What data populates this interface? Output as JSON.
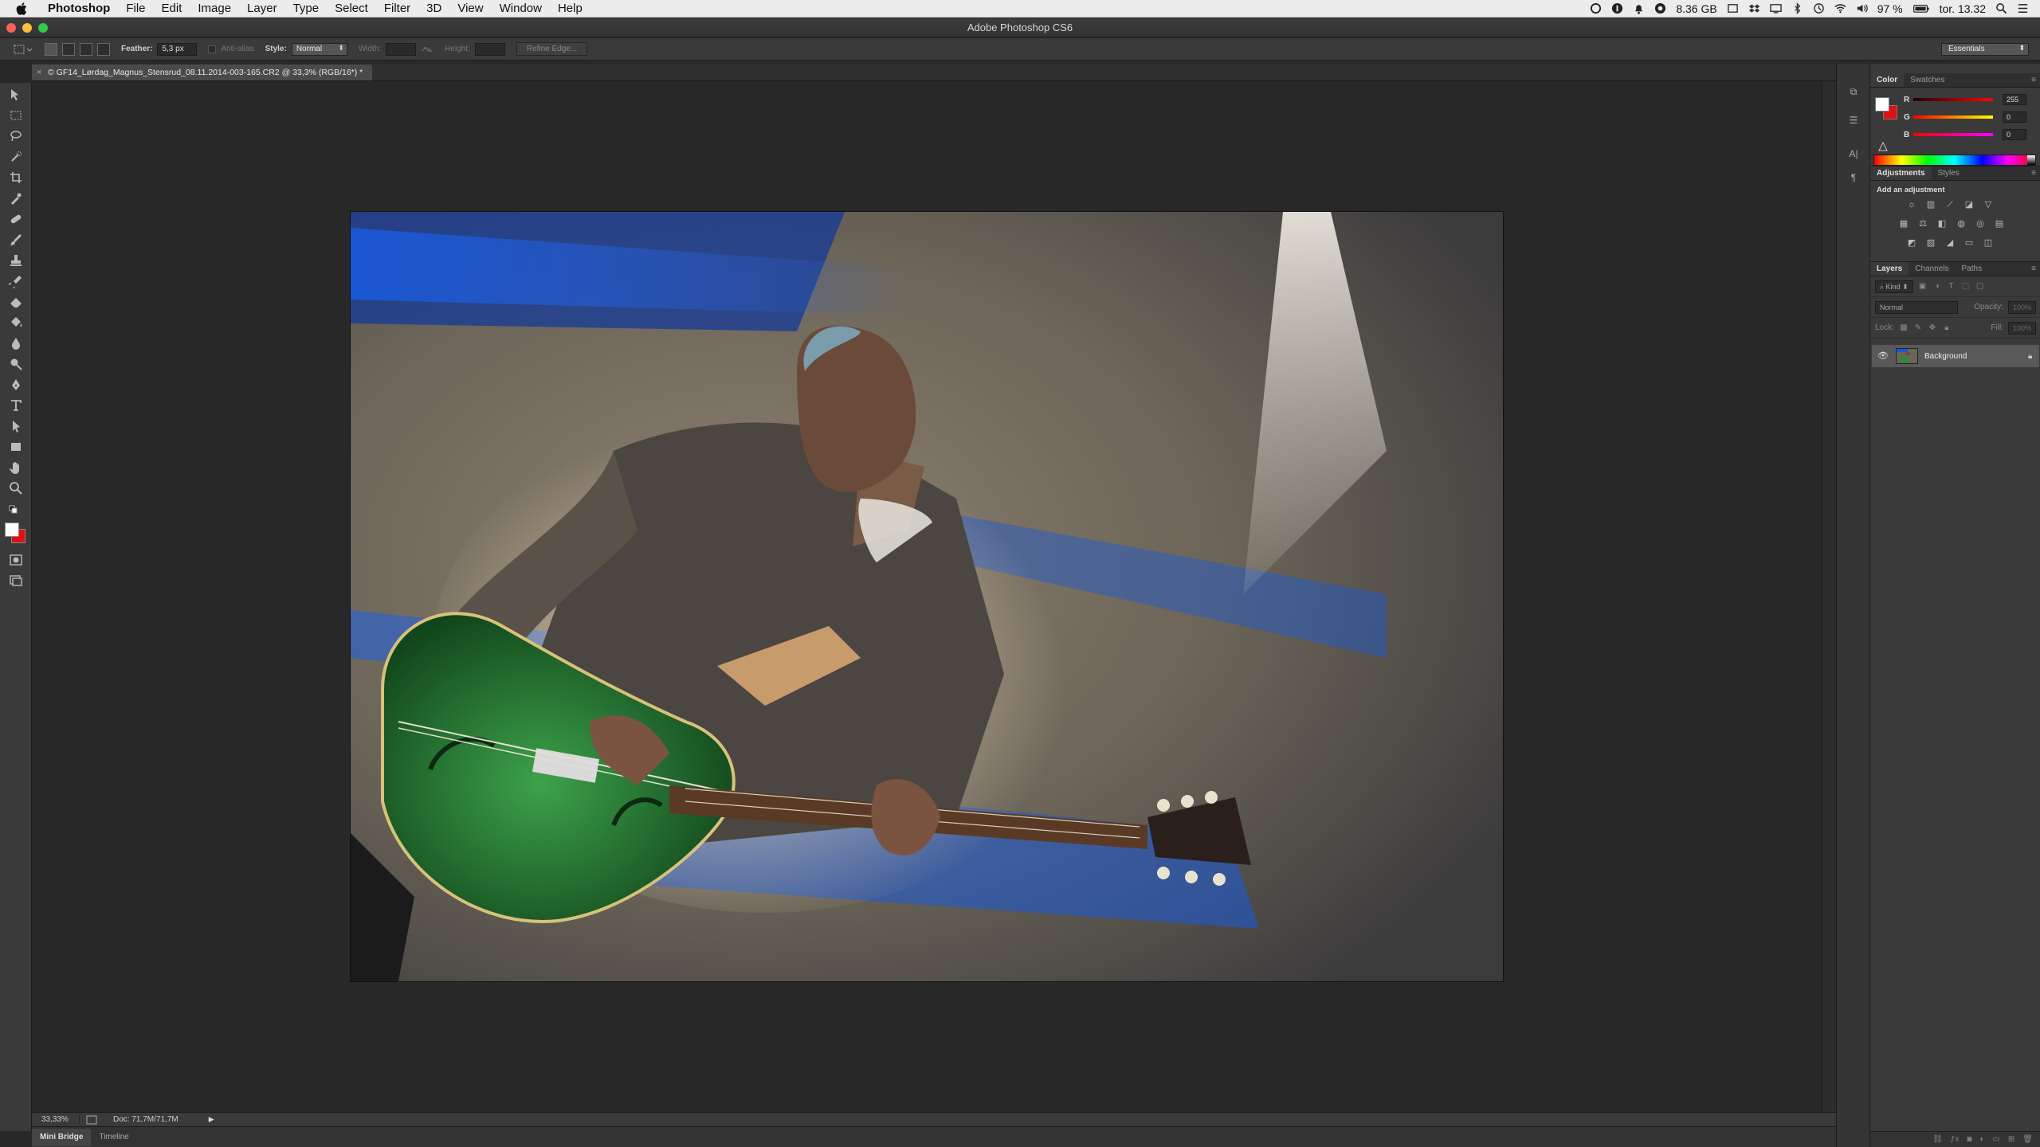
{
  "menubar": {
    "app_name": "Photoshop",
    "items": [
      "File",
      "Edit",
      "Image",
      "Layer",
      "Type",
      "Select",
      "Filter",
      "3D",
      "View",
      "Window",
      "Help"
    ],
    "status": {
      "storage": "8.36 GB",
      "battery": "97 %",
      "clock": "tor. 13.32"
    }
  },
  "window": {
    "title": "Adobe Photoshop CS6",
    "colors": {
      "close": "#fc605b",
      "minimize": "#fdbc40",
      "zoom": "#34c84a"
    }
  },
  "options_bar": {
    "feather_label": "Feather:",
    "feather_value": "5,3 px",
    "anti_alias_label": "Anti-alias",
    "style_label": "Style:",
    "style_value": "Normal",
    "width_label": "Width:",
    "height_label": "Height:",
    "refine_edge_label": "Refine Edge...",
    "workspace_value": "Essentials"
  },
  "document": {
    "tab_title": "© GF14_Lørdag_Magnus_Stensrud_08.11.2014-003-165.CR2 @ 33,3% (RGB/16*) *",
    "close_glyph": "×"
  },
  "tools": [
    "move-tool",
    "rectangular-marquee-tool",
    "lasso-tool",
    "quick-selection-tool",
    "crop-tool",
    "eyedropper-tool",
    "spot-healing-brush-tool",
    "brush-tool",
    "clone-stamp-tool",
    "history-brush-tool",
    "eraser-tool",
    "paint-bucket-tool",
    "blur-tool",
    "dodge-tool",
    "pen-tool",
    "type-tool",
    "path-selection-tool",
    "rectangle-tool",
    "hand-tool",
    "zoom-tool"
  ],
  "status_bar": {
    "zoom": "33,33%",
    "doc_info": "Doc: 71,7M/71,7M"
  },
  "bottom_tabs": [
    "Mini Bridge",
    "Timeline"
  ],
  "color_panel": {
    "tabs": [
      "Color",
      "Swatches"
    ],
    "foreground": "#ffffff",
    "background": "#e01010",
    "channels": [
      {
        "name": "R",
        "value": "255"
      },
      {
        "name": "G",
        "value": "0"
      },
      {
        "name": "B",
        "value": "0"
      }
    ]
  },
  "adjustments_panel": {
    "tabs": [
      "Adjustments",
      "Styles"
    ],
    "heading": "Add an adjustment"
  },
  "layers_panel": {
    "tabs": [
      "Layers",
      "Channels",
      "Paths"
    ],
    "kind_label": "Kind",
    "blend_mode": "Normal",
    "opacity_label": "Opacity:",
    "opacity_value": "100%",
    "lock_label": "Lock:",
    "fill_label": "Fill:",
    "fill_value": "100%",
    "layers": [
      {
        "name": "Background",
        "visible": true,
        "locked": true
      }
    ]
  }
}
